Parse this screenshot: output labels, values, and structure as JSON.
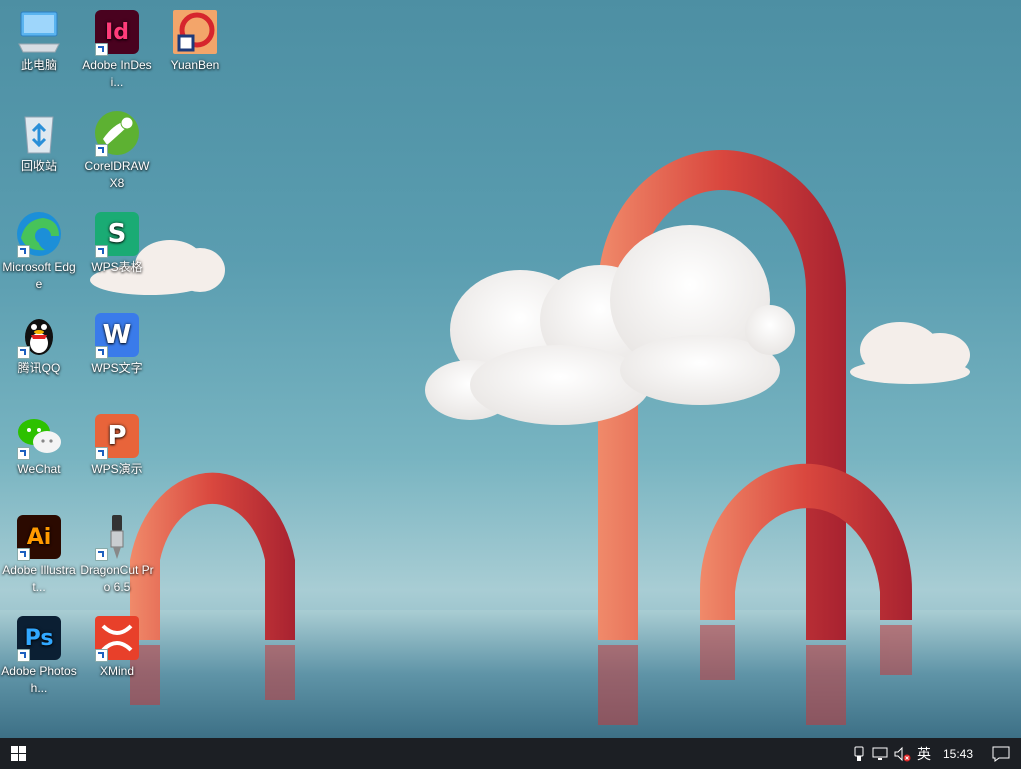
{
  "desktop": {
    "icons": [
      {
        "id": "this-pc",
        "label": "此电脑"
      },
      {
        "id": "indesign",
        "label": "Adobe InDesi...",
        "glyph": "Id",
        "color": "#49021f"
      },
      {
        "id": "yuanben",
        "label": "YuanBen"
      },
      {
        "id": "recycle-bin",
        "label": "回收站"
      },
      {
        "id": "coreldraw",
        "label": "CorelDRAW X8"
      },
      {
        "id": "edge",
        "label": "Microsoft Edge"
      },
      {
        "id": "wps-sheet",
        "label": "WPS表格",
        "glyph": "S",
        "color": "#1aab74"
      },
      {
        "id": "qq",
        "label": "腾讯QQ"
      },
      {
        "id": "wps-writer",
        "label": "WPS文字",
        "glyph": "W",
        "color": "#3a7bea"
      },
      {
        "id": "wechat",
        "label": "WeChat"
      },
      {
        "id": "wps-present",
        "label": "WPS演示",
        "glyph": "P",
        "color": "#e8643a"
      },
      {
        "id": "illustrator",
        "label": "Adobe Illustrat...",
        "glyph": "Ai",
        "color": "#2b0a00"
      },
      {
        "id": "dragoncut",
        "label": "DragonCut Pro 6.5"
      },
      {
        "id": "photoshop",
        "label": "Adobe Photosh...",
        "glyph": "Ps",
        "color": "#0b1f33"
      },
      {
        "id": "xmind",
        "label": "XMind"
      }
    ]
  },
  "taskbar": {
    "ime": "英",
    "clock": "15:43"
  },
  "colors": {
    "taskbar": "#1c1f24",
    "arch": "#c8353a",
    "sky": "#4d8fa3"
  }
}
